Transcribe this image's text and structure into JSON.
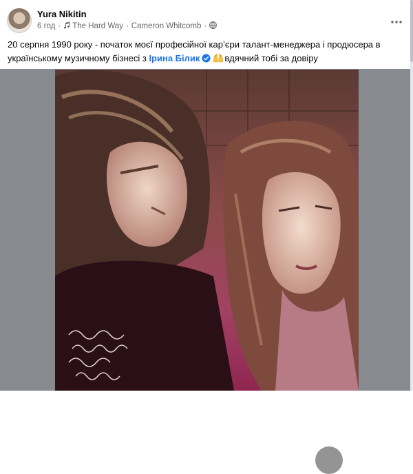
{
  "post": {
    "author": "Yura Nikitin",
    "time": "6 год",
    "music_title": "The Hard Way",
    "music_artist": "Cameron Whitcomb",
    "text_part1": "20 серпня 1990 року - початок моєї професійної кар’єри талант-менеджера і продюсера в українському музичному бізнесі з ",
    "mention": "Ірина Білик",
    "text_part2": "вдячний тобі за довіру",
    "audience": "public",
    "photo_handwriting": [
      "by Sitnchiy",
      "Sony & Virgin",
      "for Drea",
      "Bekasesiel",
      "Iden Day"
    ]
  },
  "colors": {
    "link": "#1b74e4",
    "meta": "#65676b",
    "media_bg": "#878b90"
  },
  "icons": {
    "music": "music-note-icon",
    "globe": "globe-icon",
    "verified": "verified-badge-icon",
    "more": "more-options-icon",
    "emoji": "raised-hands-emoji",
    "zoom": "zoom-icon"
  }
}
